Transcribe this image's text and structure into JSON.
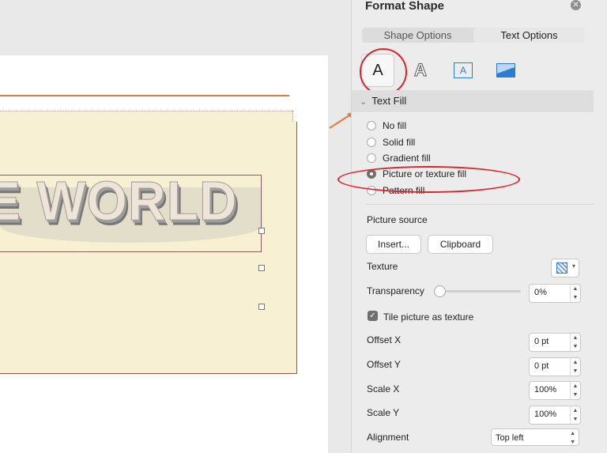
{
  "slide": {
    "wordart_text": "WORLD",
    "wordart_partial_letter": "E"
  },
  "panel": {
    "title": "Format Shape",
    "close_glyph": "✕",
    "tabs": [
      {
        "label": "Shape Options"
      },
      {
        "label": "Text Options"
      }
    ],
    "icon_row": {
      "text_fill_glyph": "A",
      "outline_glyph": "A",
      "textbox_glyph": "A"
    },
    "section_title": "Text Fill",
    "section_chevron": "⌄",
    "fill_options": [
      {
        "label": "No fill",
        "selected": false
      },
      {
        "label": "Solid fill",
        "selected": false
      },
      {
        "label": "Gradient fill",
        "selected": false
      },
      {
        "label": "Picture or texture fill",
        "selected": true
      },
      {
        "label": "Pattern fill",
        "selected": false
      }
    ],
    "picture_source_label": "Picture source",
    "insert_button": "Insert...",
    "clipboard_button": "Clipboard",
    "texture_label": "Texture",
    "texture_caret": "▾",
    "transparency": {
      "label": "Transparency",
      "value": "0%",
      "level": 0
    },
    "tile_checkbox": {
      "label": "Tile picture as texture",
      "checked": true,
      "glyph": "✓"
    },
    "offset_x": {
      "label": "Offset X",
      "value": "0 pt"
    },
    "offset_y": {
      "label": "Offset Y",
      "value": "0 pt"
    },
    "scale_x": {
      "label": "Scale X",
      "value": "100%"
    },
    "scale_y": {
      "label": "Scale Y",
      "value": "100%"
    },
    "alignment": {
      "label": "Alignment",
      "value": "Top left"
    },
    "spinner_arrows": {
      "up": "▲",
      "down": "▼"
    }
  },
  "colors": {
    "accent_orange": "#e27a3f",
    "annotation_red": "#d9262c",
    "slide_cream": "#f7f0d2"
  }
}
